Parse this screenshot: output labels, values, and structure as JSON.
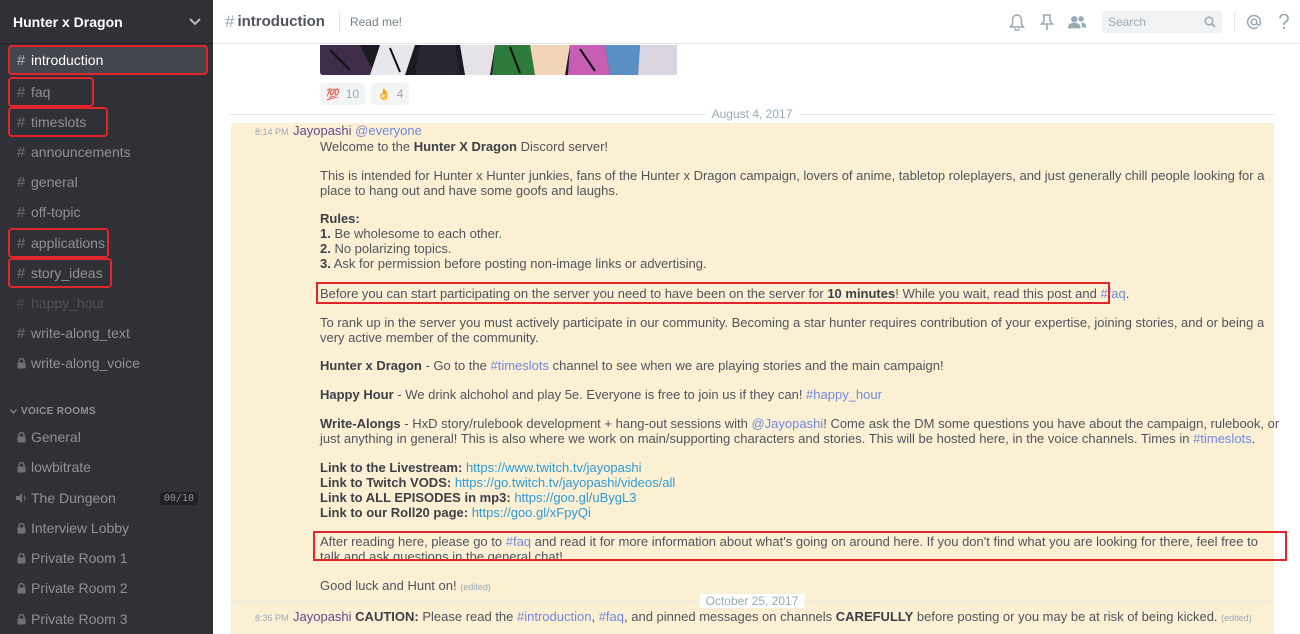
{
  "server": {
    "name": "Hunter x Dragon"
  },
  "channels": [
    {
      "name": "introduction"
    },
    {
      "name": "faq"
    },
    {
      "name": "timeslots"
    },
    {
      "name": "announcements"
    },
    {
      "name": "general"
    },
    {
      "name": "off-topic"
    },
    {
      "name": "applications"
    },
    {
      "name": "story_ideas"
    },
    {
      "name": "happy_hour"
    },
    {
      "name": "write-along_text"
    },
    {
      "name": "write-along_voice"
    }
  ],
  "voice": {
    "header": "VOICE ROOMS",
    "rooms": [
      {
        "name": "General"
      },
      {
        "name": "lowbitrate"
      },
      {
        "name": "The Dungeon",
        "count": "00/10"
      },
      {
        "name": "Interview Lobby"
      },
      {
        "name": "Private Room 1"
      },
      {
        "name": "Private Room 2"
      },
      {
        "name": "Private Room 3"
      }
    ]
  },
  "topbar": {
    "channel": "introduction",
    "topic": "Read me!",
    "search_placeholder": "Search"
  },
  "reactions": [
    {
      "emoji": "💯",
      "count": "10"
    },
    {
      "emoji": "👌",
      "count": "4"
    }
  ],
  "dates": {
    "first": "August 4, 2017",
    "second": "October 25, 2017"
  },
  "message1": {
    "time": "8:14 PM",
    "author": "Jayopashi",
    "mention": "@everyone",
    "welcome_pre": "Welcome to the ",
    "welcome_bold": "Hunter X Dragon",
    "welcome_post": " Discord server!",
    "intro": "This is intended for Hunter x Hunter junkies, fans of the Hunter x Dragon campaign, lovers of anime, tabletop roleplayers, and just generally chill people looking for a place to hang out and have some goofs and laughs.",
    "rules_title": "Rules:",
    "rules": [
      {
        "num": "1.",
        "text": " Be wholesome to each other."
      },
      {
        "num": "2.",
        "text": " No polarizing topics."
      },
      {
        "num": "3.",
        "text": " Ask for permission before posting non-image links or advertising."
      }
    ],
    "wait_pre": "Before you can start participating on the server you need to have been on the server for ",
    "wait_bold": "10 minutes",
    "wait_post": "! While you wait, read this post and ",
    "wait_link": "#faq",
    "wait_end": ".",
    "rank": "To rank up in the server you must actively participate in our community. Becoming a star hunter requires contribution of your expertise, joining stories, and or being a very active member of the community.",
    "hxd_bold": "Hunter x Dragon",
    "hxd_pre": " - Go to the ",
    "hxd_link": "#timeslots",
    "hxd_post": " channel to see when we are playing stories and the main campaign!",
    "hh_bold": "Happy Hour",
    "hh_text": " - We drink alchohol and play 5e. Everyone is free to join us if they can! ",
    "hh_link": "#happy_hour",
    "wa_bold": "Write-Alongs",
    "wa_pre": " - HxD story/rulebook development + hang-out sessions with ",
    "wa_mention": "@Jayopashi",
    "wa_mid": "! Come ask the DM some questions you have about the campaign, rulebook, or just anything in general! This is also where we work on main/supporting characters and stories. This will be hosted here, in the voice channels. Times in ",
    "wa_link": "#timeslots",
    "wa_end": ".",
    "links": [
      {
        "label": "Link to the Livestream:",
        "url": "https://www.twitch.tv/jayopashi"
      },
      {
        "label": "Link to Twitch VODS:",
        "url": "https://go.twitch.tv/jayopashi/videos/all"
      },
      {
        "label": "Link to ALL EPISODES in mp3:",
        "url": "https://goo.gl/uBygL3"
      },
      {
        "label": "Link to our Roll20 page:",
        "url": "https://goo.gl/xFpyQi"
      }
    ],
    "after_pre": "After reading here, please go to ",
    "after_link": "#faq",
    "after_post": " and read it for more information about what's going on around here. If you don't find what you are looking for there, feel free to talk and ask questions in the general chat!",
    "goodluck": "Good luck and Hunt on!",
    "edited": "(edited)"
  },
  "message2": {
    "time": "8:36 PM",
    "author": "Jayopashi",
    "caution_bold": "CAUTION:",
    "caution_pre": " Please read the ",
    "caution_link1": "#introduction",
    "caution_comma": ", ",
    "caution_link2": "#faq",
    "caution_mid": ", and pinned messages on channels ",
    "caution_bold2": "CAREFULLY",
    "caution_post": " before posting or you may be at risk of being kicked.",
    "edited": "(edited)"
  },
  "colors": {
    "sidebar": "#2f3136",
    "highlight": "#fbf0d4",
    "annotation": "#e0262b",
    "mention": "#7289da",
    "link": "#2e9ad6"
  }
}
